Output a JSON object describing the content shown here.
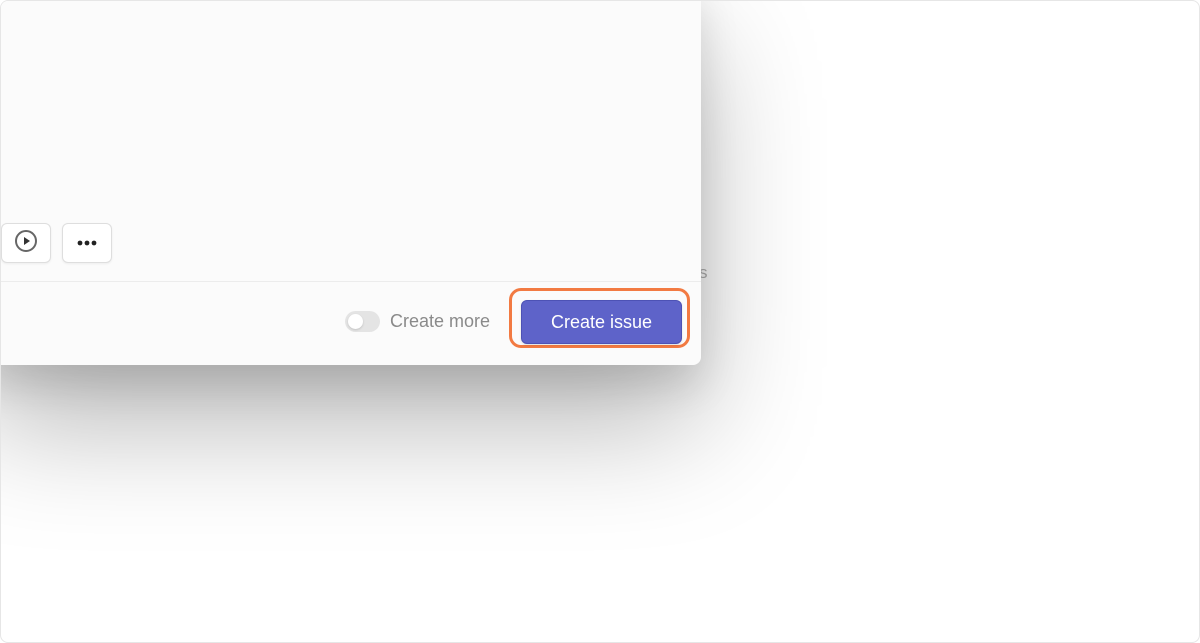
{
  "background": {
    "partial_text": "s"
  },
  "modal": {
    "toolbar": {
      "play_icon": "play-circle-icon",
      "more_icon": "more-horizontal-icon"
    },
    "footer": {
      "toggle_label": "Create more",
      "toggle_on": false,
      "primary_label": "Create issue"
    }
  },
  "colors": {
    "primary": "#5e63c9",
    "highlight": "#f27a42"
  }
}
